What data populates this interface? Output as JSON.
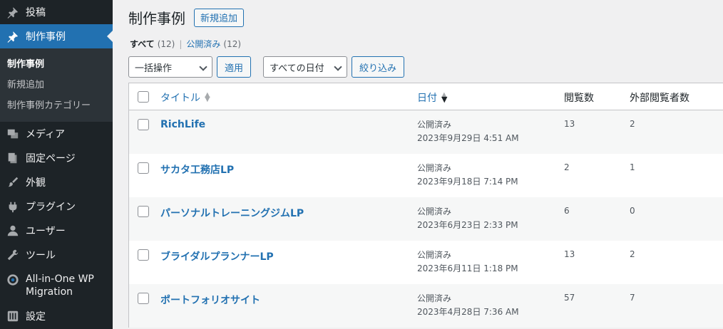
{
  "sidebar": {
    "items": [
      {
        "label": "投稿",
        "icon": "pin-icon"
      },
      {
        "label": "制作事例",
        "icon": "pin-icon",
        "active": true
      },
      {
        "label": "メディア",
        "icon": "media-icon"
      },
      {
        "label": "固定ページ",
        "icon": "page-icon"
      },
      {
        "label": "外観",
        "icon": "brush-icon"
      },
      {
        "label": "プラグイン",
        "icon": "plugin-icon"
      },
      {
        "label": "ユーザー",
        "icon": "user-icon"
      },
      {
        "label": "ツール",
        "icon": "wrench-icon"
      },
      {
        "label": "All-in-One WP Migration",
        "icon": "migration-icon"
      },
      {
        "label": "設定",
        "icon": "settings-icon"
      }
    ],
    "submenu": [
      "制作事例",
      "新規追加",
      "制作事例カテゴリー"
    ]
  },
  "header": {
    "title": "制作事例",
    "add_new": "新規追加"
  },
  "filters": {
    "all_label": "すべて",
    "all_count": "(12)",
    "separator": "|",
    "published_label": "公開済み",
    "published_count": "(12)"
  },
  "tablenav": {
    "bulk_action": "一括操作",
    "apply": "適用",
    "all_dates": "すべての日付",
    "filter": "絞り込み"
  },
  "table": {
    "columns": {
      "title": "タイトル",
      "date": "日付",
      "views": "閲覧数",
      "external_views": "外部閲覧者数"
    },
    "rows": [
      {
        "title": "RichLife",
        "status": "公開済み",
        "date": "2023年9月29日 4:51 AM",
        "views": "13",
        "external": "2"
      },
      {
        "title": "サカタ工務店LP",
        "status": "公開済み",
        "date": "2023年9月18日 7:14 PM",
        "views": "2",
        "external": "1"
      },
      {
        "title": "パーソナルトレーニングジムLP",
        "status": "公開済み",
        "date": "2023年6月23日 2:33 PM",
        "views": "6",
        "external": "0"
      },
      {
        "title": "ブライダルプランナーLP",
        "status": "公開済み",
        "date": "2023年6月11日 1:18 PM",
        "views": "13",
        "external": "2"
      },
      {
        "title": "ポートフォリオサイト",
        "status": "公開済み",
        "date": "2023年4月28日 7:36 AM",
        "views": "57",
        "external": "7"
      }
    ]
  }
}
